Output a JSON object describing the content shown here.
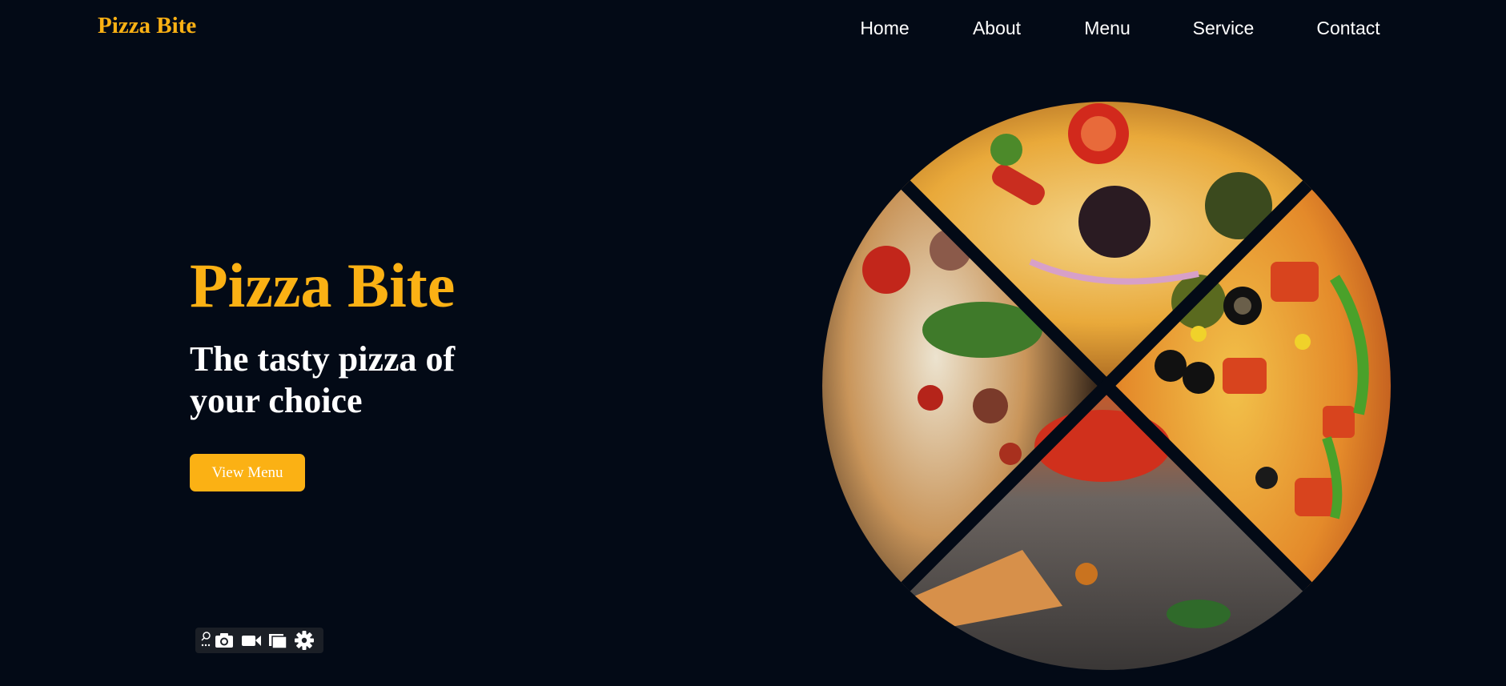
{
  "header": {
    "brand": "Pizza Bite",
    "nav": [
      {
        "label": "Home"
      },
      {
        "label": "About"
      },
      {
        "label": "Menu"
      },
      {
        "label": "Service"
      },
      {
        "label": "Contact"
      }
    ]
  },
  "hero": {
    "title": "Pizza Bite",
    "subtitle": "The tasty pizza of your choice",
    "cta_label": "View Menu"
  },
  "toolbar": {
    "icons": [
      "extension-icon",
      "camera-icon",
      "video-camera-icon",
      "window-icon",
      "gear-icon"
    ]
  },
  "colors": {
    "background": "#030a16",
    "accent": "#fbb114",
    "text": "#ffffff"
  }
}
